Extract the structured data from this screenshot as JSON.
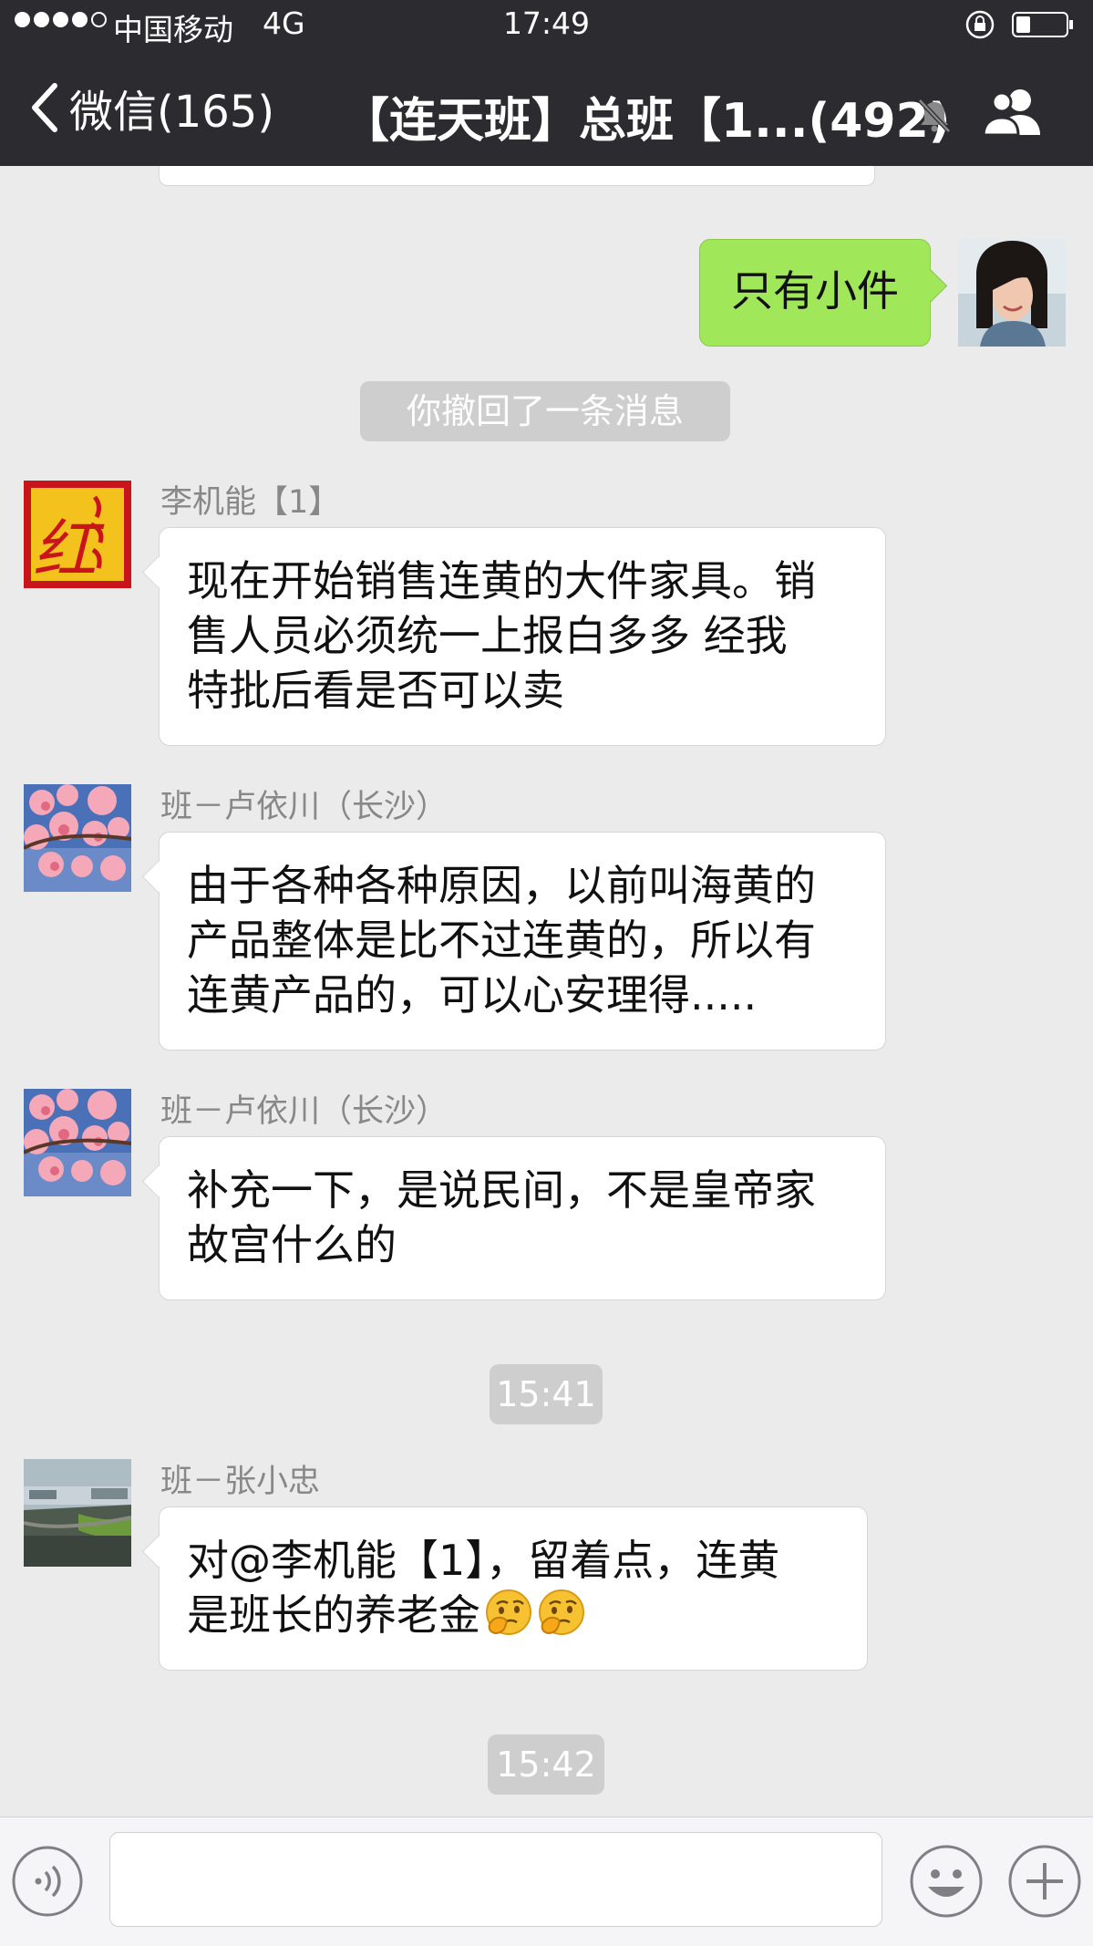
{
  "status_bar": {
    "carrier": "中国移动",
    "network": "4G",
    "time": "17:49"
  },
  "nav": {
    "back_label": "微信(165)",
    "title": "【连天班】总班【1...(492)"
  },
  "messages": {
    "self_message": "只有小件",
    "recalled_notice": "你撤回了一条消息",
    "msg1": {
      "sender": "李机能【1】",
      "lines": [
        "现在开始销售连黄的大件家具。销",
        "售人员必须统一上报白多多  经我",
        "特批后看是否可以卖"
      ]
    },
    "msg2": {
      "sender": "班－卢依川（长沙）",
      "lines": [
        "由于各种各种原因，以前叫海黄的",
        "产品整体是比不过连黄的，所以有",
        "连黄产品的，可以心安理得....."
      ]
    },
    "msg3": {
      "sender": "班－卢依川（长沙）",
      "lines": [
        "补充一下，是说民间，不是皇帝家",
        "故宫什么的"
      ]
    },
    "time_1": "15:41",
    "msg4": {
      "sender": "班－张小忠",
      "line1": "对@李机能【1】，留着点，连黄",
      "line2": "是班长的养老金"
    },
    "time_2": "15:42"
  },
  "avatars": {
    "li_jineng_logo_text": "红"
  },
  "input": {
    "value": "",
    "placeholder": ""
  },
  "colors": {
    "nav_bg": "#2c2c30",
    "chat_bg": "#ebebeb",
    "self_bubble": "#a0e75a",
    "other_bubble": "#ffffff"
  }
}
